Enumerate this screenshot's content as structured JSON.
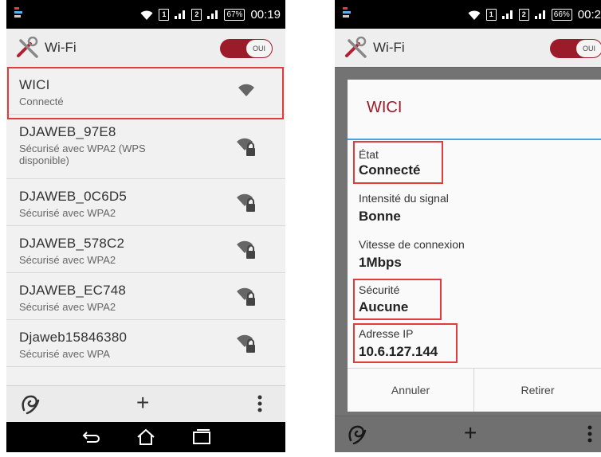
{
  "left": {
    "status": {
      "battery": "67%",
      "time": "00:19",
      "sim1": "1",
      "sim2": "2"
    },
    "title": "Wi-Fi",
    "toggle_label": "OUI",
    "networks": [
      {
        "name": "WICI",
        "status": "Connecté"
      },
      {
        "name": "DJAWEB_97E8",
        "status": "Sécurisé avec WPA2 (WPS disponible)"
      },
      {
        "name": "DJAWEB_0C6D5",
        "status": "Sécurisé avec WPA2"
      },
      {
        "name": "DJAWEB_578C2",
        "status": "Sécurisé avec WPA2"
      },
      {
        "name": "DJAWEB_EC748",
        "status": "Sécurisé avec WPA2"
      },
      {
        "name": "Djaweb15846380",
        "status": "Sécurisé avec WPA"
      }
    ],
    "actions": {
      "add": "+"
    }
  },
  "right": {
    "status": {
      "battery": "66%",
      "time": "00:2",
      "sim1": "1",
      "sim2": "2"
    },
    "title": "Wi-Fi",
    "toggle_label": "OUI",
    "dialog": {
      "title": "WICI",
      "fields": [
        {
          "label": "État",
          "value": "Connecté"
        },
        {
          "label": "Intensité du signal",
          "value": "Bonne"
        },
        {
          "label": "Vitesse de connexion",
          "value": "1Mbps"
        },
        {
          "label": "Sécurité",
          "value": "Aucune"
        },
        {
          "label": "Adresse IP",
          "value": "10.6.127.144"
        }
      ],
      "cancel": "Annuler",
      "remove": "Retirer"
    },
    "actions": {
      "add": "+"
    }
  },
  "colors": {
    "accent": "#9b1b2b",
    "highlight": "#e23b3b",
    "rule": "#4aa3df"
  }
}
